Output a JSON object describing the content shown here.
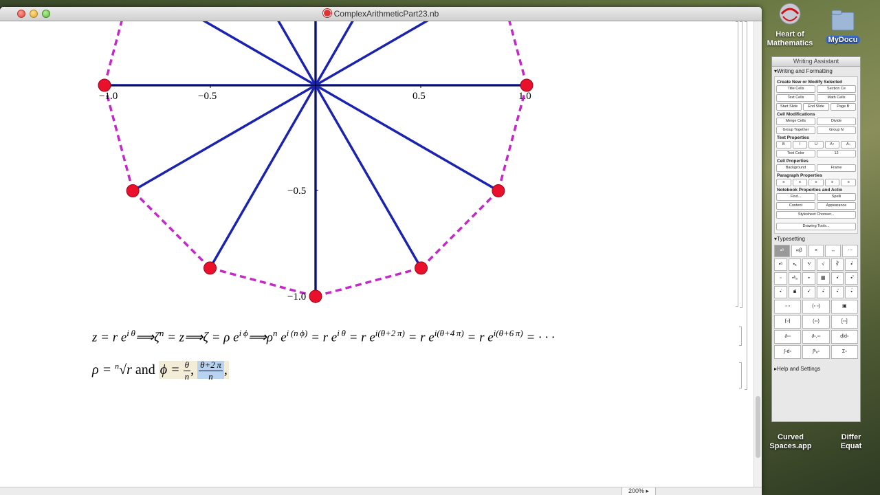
{
  "window": {
    "title": "ComplexArithmeticPart23.nb",
    "zoom": "200%"
  },
  "plot": {
    "x_ticks": [
      "−1.0",
      "−0.5",
      "0.5",
      "1.0"
    ],
    "y_ticks": [
      "−0.5",
      "−1.0"
    ]
  },
  "chart_data": {
    "type": "scatter",
    "points_x": [
      1.0,
      0.866,
      0.5,
      0.0,
      -0.5,
      -0.866,
      -1.0
    ],
    "points_y": [
      0.0,
      -0.5,
      -0.866,
      -1.0,
      -0.866,
      -0.5,
      0.0
    ],
    "xlim": [
      -1.0,
      1.0
    ],
    "ylim": [
      -1.0,
      0.3
    ],
    "colors": {
      "spokes": "#1a22b0",
      "polygon": "#c428c8",
      "points": "#e8102a"
    }
  },
  "formulas": {
    "line1": "z = r e",
    "line1_exp1": "i θ",
    "line1_b": "⟹ζ",
    "line1_exp2": "n",
    "line1_c": " = z⟹ζ = ρ e",
    "line1_exp3": "i ϕ",
    "line1_d": "⟹ρ",
    "line1_exp4": "n",
    "line1_e": " e",
    "line1_exp5": "i (n ϕ)",
    "line1_f": " = r e",
    "line1_exp6": "i θ",
    "line1_g": " = r e",
    "line1_exp7": "i(θ+2 π)",
    "line1_h": " = r e",
    "line1_exp8": "i(θ+4 π)",
    "line1_i": " = r e",
    "line1_exp9": "i(θ+6 π)",
    "line1_j": " = · · ·",
    "line2_rho": "ρ = ",
    "line2_root_index": "n",
    "line2_root": "√r",
    "line2_and": " and ",
    "line2_phi": "ϕ = ",
    "frac1_num": "θ",
    "frac1_den": "n",
    "comma": ",",
    "frac2_num": "θ+2 π",
    "frac2_den": "n"
  },
  "desktop": {
    "icon1": "Heart of Mathematics",
    "icon2": "MyDocu",
    "icon3": "Curved Spaces.app",
    "icon4": "Differ Equat"
  },
  "palette": {
    "title": "Writing Assistant",
    "section1": "Writing and Formatting",
    "sub1": "Create New or Modify Selected",
    "b1": "Title Cells",
    "b2": "Section Ce",
    "b3": "Text Cells",
    "b4": "Math Cells",
    "b5": "Start Slide",
    "b6": "End Slide",
    "b7": "Page B",
    "sub2": "Cell Modifications",
    "b8": "Merge Cells",
    "b9": "Divide",
    "b10": "Group Together",
    "b11": "Group N",
    "sub3": "Text Properties",
    "b12": "B",
    "b13": "I",
    "b14": "U",
    "b15": "A↑",
    "b16": "A↓",
    "b17": "Text Color",
    "b18": "12",
    "sub4": "Cell Properties",
    "b19": "Background",
    "b20": "Frame",
    "sub5": "Paragraph Properties",
    "sub6": "Notebook Properties and Actio",
    "b21": "Find...",
    "b22": "Spelli",
    "b23": "Content",
    "b24": "Appearance",
    "b25": "Stylesheet Chooser...",
    "b26": "Drawing Tools...",
    "section2": "Typesetting",
    "section3": "Help and Settings"
  }
}
